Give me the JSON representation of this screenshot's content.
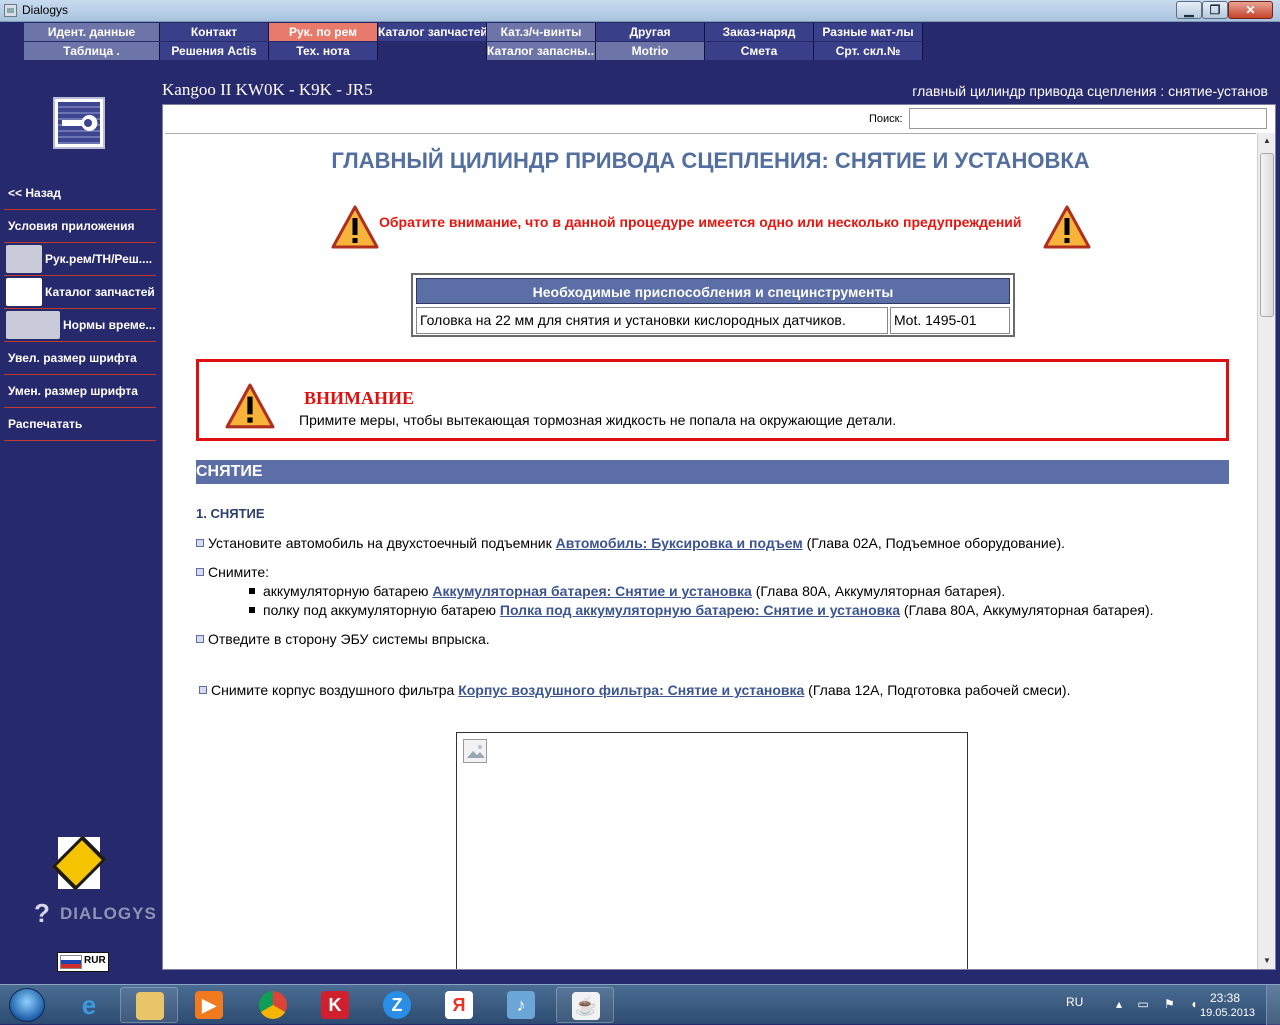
{
  "window": {
    "title": "Dialogys"
  },
  "tabs": {
    "row1": [
      "Идент. данные",
      "Контакт",
      "Рук. по рем",
      "Каталог запчастей",
      "Кат.з/ч-винты",
      "Другая",
      "Заказ-наряд",
      "Разные мат-лы"
    ],
    "row2": [
      "Таблица .",
      "Решения Actis",
      "Тех. нота",
      "",
      "Каталог запасны...",
      "Motrio",
      "Смета",
      "Срт. скл.№"
    ]
  },
  "sidebar": {
    "items": [
      "<< Назад",
      "Условия приложения",
      "Рук.рем/ТН/Реш....",
      "Каталог запчастей",
      "Нормы време...",
      "Увел. размер шрифта",
      "Умен. размер шрифта",
      "Распечатать"
    ],
    "brand_text": "DIALOGYS",
    "lang_code": "RUR"
  },
  "header": {
    "vehicle": "Kangoo II KW0K - K9K - JR5",
    "section": "главный цилиндр привода сцепления : снятие-установ"
  },
  "search": {
    "label": "Поиск:",
    "value": ""
  },
  "doc": {
    "title": "ГЛАВНЫЙ ЦИЛИНДР ПРИВОДА СЦЕПЛЕНИЯ: СНЯТИЕ И УСТАНОВКА",
    "warning_note": "Обратите внимание, что в данной процедуре имеется одно или несколько предупреждений",
    "tools": {
      "header": "Необходимые приспособления и специнструменты",
      "item": "Головка на 22 мм для снятия и установки кислородных датчиков.",
      "ref": "Mot. 1495-01"
    },
    "caution": {
      "heading": "ВНИМАНИЕ",
      "text": "Примите меры, чтобы вытекающая тормозная жидкость не попала на окружающие детали."
    },
    "section_bar": "СНЯТИЕ",
    "step_heading": "1. СНЯТИЕ",
    "b1": {
      "pre": "Установите автомобиль на двухстоечный подъемник ",
      "link": "Автомобиль: Буксировка и подъем",
      "post": " (Глава 02А, Подъемное оборудование)."
    },
    "b2": {
      "pre": "Снимите:"
    },
    "s1": {
      "pre": "аккумуляторную батарею ",
      "link": "Аккумуляторная батарея: Снятие и установка",
      "post": " (Глава 80А, Аккумуляторная батарея)."
    },
    "s2": {
      "pre": "полку под аккумуляторную батарею ",
      "link": "Полка под аккумуляторную батарею: Снятие и установка",
      "post": " (Глава 80А, Аккумуляторная батарея)."
    },
    "b3": {
      "pre": "Отведите в сторону ЭБУ системы впрыска."
    },
    "b4": {
      "pre": "Снимите корпус воздушного фильтра ",
      "link": "Корпус воздушного фильтра: Снятие и установка",
      "post": " (Глава 12А, Подготовка рабочей смеси)."
    }
  },
  "taskbar": {
    "apps": [
      "internet-explorer",
      "file-explorer",
      "media-player",
      "chrome",
      "kaspersky",
      "z-app",
      "yandex",
      "sound",
      "java"
    ],
    "lang": "RU",
    "time": "23:38",
    "date": "19.05.2013"
  },
  "colors": {
    "frame": "#27296d",
    "accent_bar": "#5b6ea6",
    "warning_red": "#e8140e",
    "active_tab": "#e87a6b",
    "link": "#3c5590"
  }
}
